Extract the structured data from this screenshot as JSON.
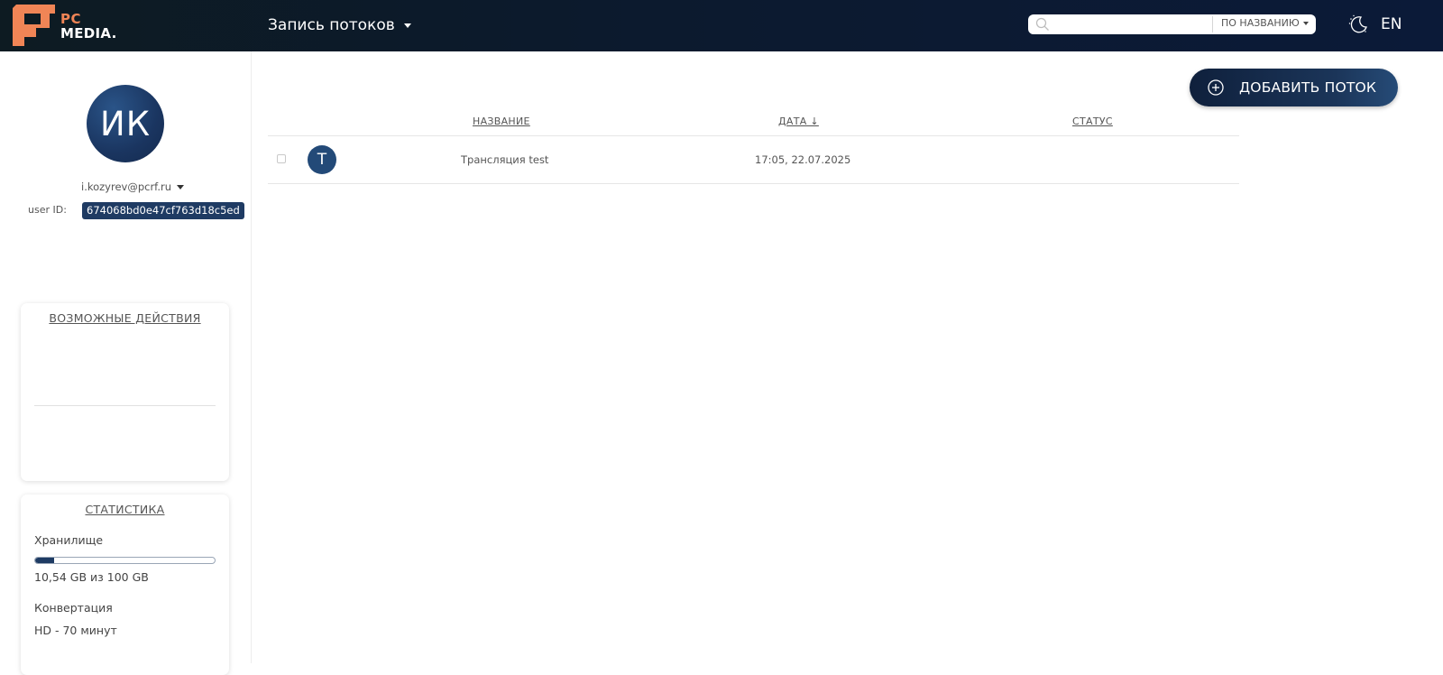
{
  "header": {
    "logo": {
      "line1": "PC",
      "line2": "MEDIA."
    },
    "section_selector": "Запись потоков",
    "search": {
      "placeholder": "",
      "value": "",
      "mode": "ПО НАЗВАНИЮ"
    },
    "theme_icon": "moon-icon",
    "language": "EN"
  },
  "sidebar": {
    "avatar_initials": "ИК",
    "email": "i.kozyrev@pcrf.ru",
    "user_id_label": "user ID:",
    "user_id": "674068bd0e47cf763d18c5ed",
    "actions_card": {
      "title": "ВОЗМОЖНЫЕ ДЕЙСТВИЯ"
    },
    "stats_card": {
      "title": "СТАТИСТИКА",
      "storage_label": "Хранилище",
      "storage_used_fraction": 0.1054,
      "storage_text": "10,54 GB из 100 GB",
      "conversion_label": "Конвертация",
      "conversion_hd": "HD - 70 минут"
    }
  },
  "main": {
    "add_button": "ДОБАВИТЬ ПОТОК",
    "columns": {
      "name": "НАЗВАНИЕ",
      "date": "ДАТА ↓",
      "status": "СТАТУС"
    },
    "rows": [
      {
        "initial": "T",
        "name": "Трансляция test",
        "date": "17:05, 22.07.2025",
        "status": ""
      }
    ]
  },
  "colors": {
    "header_bg": "#0c1a2e",
    "accent_navy": "#1f3b63",
    "logo_orange": "#f08556"
  }
}
